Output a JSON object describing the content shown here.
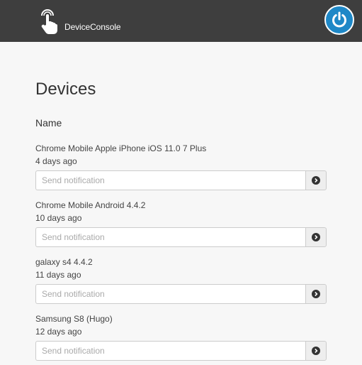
{
  "header": {
    "brand": "DeviceConsole",
    "brand_icon": "touch-hand-icon",
    "power_icon": "power-icon",
    "power_color": "#1e88c7",
    "background": "#3e3e3e"
  },
  "main": {
    "title": "Devices",
    "column_header": "Name",
    "devices": [
      {
        "name": "Chrome Mobile Apple iPhone iOS 11.0 7 Plus",
        "last_seen": "4 days ago",
        "placeholder": "Send notification"
      },
      {
        "name": "Chrome Mobile Android 4.4.2",
        "last_seen": "10 days ago",
        "placeholder": "Send notification"
      },
      {
        "name": "galaxy s4 4.4.2",
        "last_seen": "11 days ago",
        "placeholder": "Send notification"
      },
      {
        "name": "Samsung S8 (Hugo)",
        "last_seen": "12 days ago",
        "placeholder": "Send notification"
      }
    ]
  }
}
